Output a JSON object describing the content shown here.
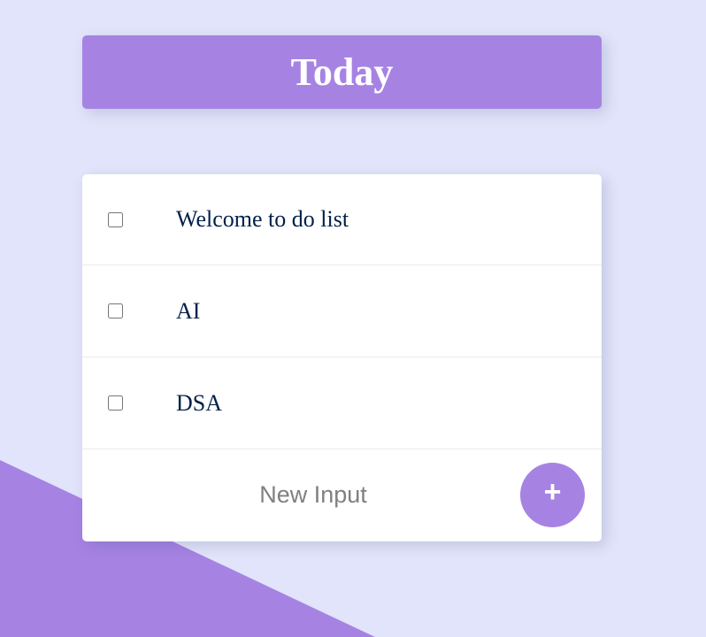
{
  "colors": {
    "background": "#e1e4fa",
    "accent": "#a683e3",
    "card": "#ffffff",
    "item_text": "#00204a"
  },
  "heading": {
    "title": "Today"
  },
  "items": [
    {
      "text": "Welcome to do list",
      "checked": false
    },
    {
      "text": "AI",
      "checked": false
    },
    {
      "text": "DSA",
      "checked": false
    }
  ],
  "new_item": {
    "placeholder": "New Input",
    "value": "",
    "add_label": "+",
    "add_icon": "plus-icon"
  }
}
